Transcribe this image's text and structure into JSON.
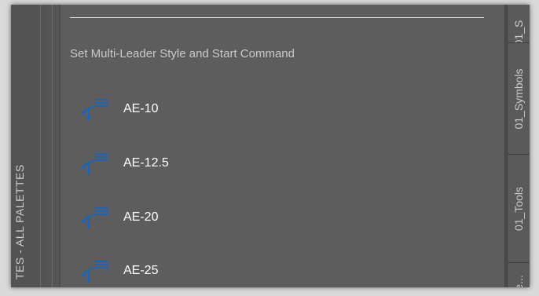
{
  "palette_title": "TES - ALL PALETTES",
  "section_label": "Set Multi-Leader Style and Start Command",
  "tools": [
    {
      "label": "AE-10",
      "icon": "multileader-icon"
    },
    {
      "label": "AE-12.5",
      "icon": "multileader-icon"
    },
    {
      "label": "AE-20",
      "icon": "multileader-icon"
    },
    {
      "label": "AE-25",
      "icon": "multileader-icon"
    }
  ],
  "tabs": [
    "01_S",
    "01_Symbols",
    "01_Tools",
    "e..."
  ],
  "colors": {
    "icon": "#1e63b5",
    "background": "#5d5d5d",
    "text": "#ffffff"
  }
}
